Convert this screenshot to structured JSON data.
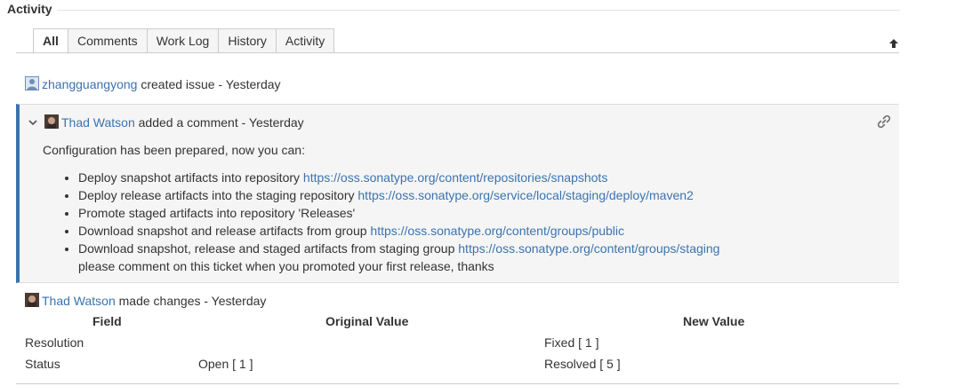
{
  "section": {
    "title": "Activity"
  },
  "tabs": [
    {
      "label": "All",
      "active": true
    },
    {
      "label": "Comments",
      "active": false
    },
    {
      "label": "Work Log",
      "active": false
    },
    {
      "label": "History",
      "active": false
    },
    {
      "label": "Activity",
      "active": false
    }
  ],
  "sort_icon": "arrow-up-icon",
  "colors": {
    "link": "#3b73af",
    "comment_bg": "#f5f5f5",
    "accent_bar": "#3b73af"
  },
  "entries": {
    "created": {
      "user": "zhangguangyong",
      "action": "created issue - Yesterday"
    },
    "comment": {
      "user": "Thad Watson",
      "action": "added a comment - Yesterday",
      "intro": "Configuration has been prepared, now you can:",
      "items": [
        {
          "text": "Deploy snapshot artifacts into repository ",
          "link": "https://oss.sonatype.org/content/repositories/snapshots"
        },
        {
          "text": "Deploy release artifacts into the staging repository ",
          "link": "https://oss.sonatype.org/service/local/staging/deploy/maven2"
        },
        {
          "text": "Promote staged artifacts into repository 'Releases'",
          "link": ""
        },
        {
          "text": "Download snapshot and release artifacts from group ",
          "link": "https://oss.sonatype.org/content/groups/public"
        },
        {
          "text": "Download snapshot, release and staged artifacts from staging group ",
          "link": "https://oss.sonatype.org/content/groups/staging"
        }
      ],
      "trailer": "please comment on this ticket when you promoted your first release, thanks"
    },
    "changes": {
      "user": "Thad Watson",
      "action": "made changes - Yesterday",
      "headers": {
        "field": "Field",
        "original": "Original Value",
        "new": "New Value"
      },
      "rows": [
        {
          "field": "Resolution",
          "original": "",
          "new": "Fixed [ 1 ]"
        },
        {
          "field": "Status",
          "original": "Open [ 1 ]",
          "new": "Resolved [ 5 ]"
        }
      ]
    }
  }
}
